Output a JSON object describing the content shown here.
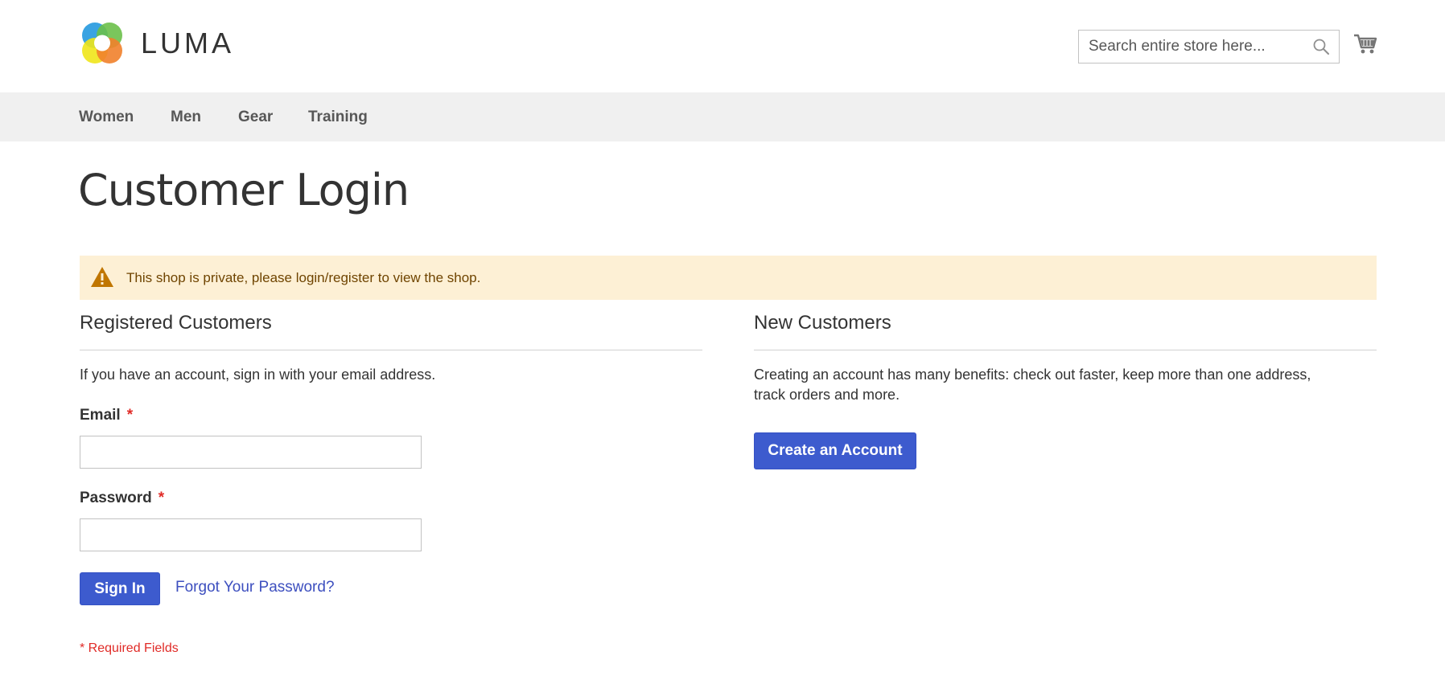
{
  "brand": {
    "name": "LUMA"
  },
  "search": {
    "placeholder": "Search entire store here..."
  },
  "nav": {
    "items": [
      {
        "label": "Women"
      },
      {
        "label": "Men"
      },
      {
        "label": "Gear"
      },
      {
        "label": "Training"
      }
    ]
  },
  "page": {
    "title": "Customer Login"
  },
  "notice": {
    "text": "This shop is private, please login/register to view the shop."
  },
  "registered": {
    "title": "Registered Customers",
    "intro": "If you have an account, sign in with your email address.",
    "email_label": "Email",
    "email_value": "",
    "password_label": "Password",
    "password_value": "",
    "required_marker": "*",
    "sign_in_label": "Sign In",
    "forgot_label": "Forgot Your Password?"
  },
  "new_customers": {
    "title": "New Customers",
    "text_line1": "Creating an account has many benefits: check out faster, keep more than one address,",
    "text_line2": "track orders and more.",
    "create_label": "Create an Account"
  },
  "footer_note": {
    "text": "* Required Fields"
  },
  "colors": {
    "primary_button": "#3d5bce",
    "link": "#3d4fbf",
    "required": "#e02b27",
    "notice_bg": "#fdf0d5",
    "notice_text": "#6f4400",
    "nav_bg": "#f0f0f0"
  },
  "icons": {
    "logo": "luma-logo-icon",
    "search": "search-icon",
    "cart": "cart-icon",
    "warning": "warning-icon"
  }
}
